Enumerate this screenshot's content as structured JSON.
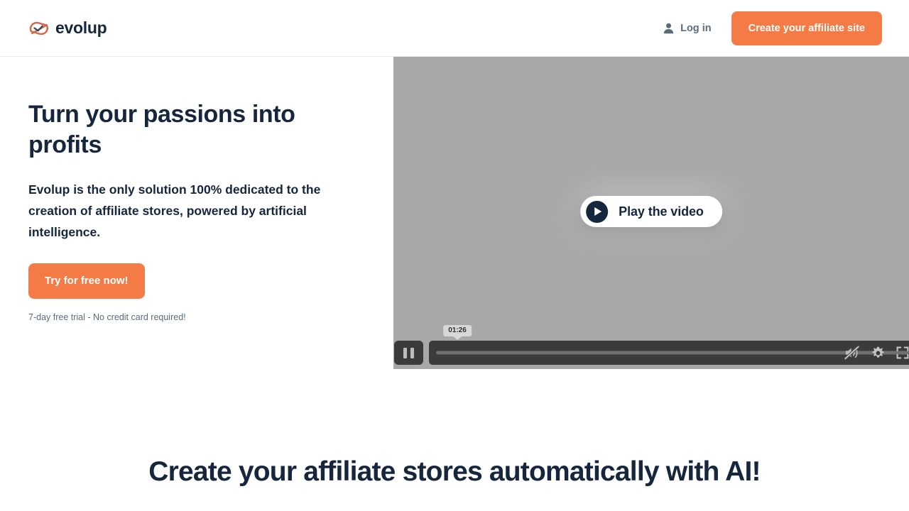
{
  "brand": {
    "name": "evolup",
    "logo_icon": "evolup-wave-logo",
    "accent_color": "#f47b45",
    "dark_color": "#16263d"
  },
  "header": {
    "login": {
      "label": "Log in",
      "icon": "user-icon"
    },
    "cta_label": "Create your affiliate site"
  },
  "hero": {
    "title": "Turn your passions into profits",
    "subtitle": "Evolup is the only solution 100% dedicated to the creation of affiliate stores, powered by artificial intelligence.",
    "cta_label": "Try for free now!",
    "trial_note": "7-day free trial - No credit card required!"
  },
  "video": {
    "play_label": "Play the video",
    "play_icon": "play-icon",
    "background_color": "#a8a8a8",
    "controls": {
      "pause_icon": "pause-icon",
      "current_time": "01:26",
      "progress_percent": 0,
      "mute_icon": "volume-muted-icon",
      "settings_icon": "gear-icon",
      "fullscreen_icon": "fullscreen-icon"
    }
  },
  "section": {
    "heading": "Create your affiliate stores automatically with AI!"
  }
}
